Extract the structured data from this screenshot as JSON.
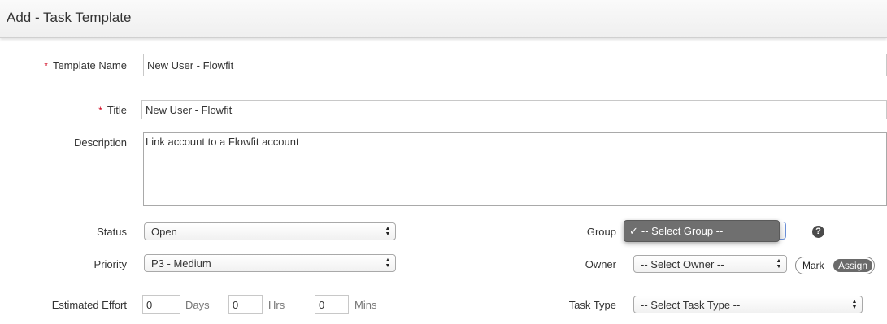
{
  "header": {
    "title": "Add - Task Template"
  },
  "form": {
    "template_name": {
      "label": "Template Name",
      "required_mark": "*",
      "value": "New User - Flowfit"
    },
    "title": {
      "label": "Title",
      "required_mark": "*",
      "value": "New User - Flowfit"
    },
    "description": {
      "label": "Description",
      "value": "Link account to a Flowfit account"
    },
    "status": {
      "label": "Status",
      "value": "Open"
    },
    "priority": {
      "label": "Priority",
      "value": "P3 - Medium"
    },
    "estimated_effort": {
      "label": "Estimated Effort",
      "days": {
        "value": "0",
        "unit": "Days"
      },
      "hrs": {
        "value": "0",
        "unit": "Hrs"
      },
      "mins": {
        "value": "0",
        "unit": "Mins"
      }
    },
    "group": {
      "label": "Group",
      "dropdown_selected": "-- Select Group --",
      "check": "✓"
    },
    "help_icon": {
      "symbol": "?"
    },
    "owner": {
      "label": "Owner",
      "value": "-- Select Owner --"
    },
    "owner_toggle": {
      "mark_label": "Mark",
      "assign_label": "Assign"
    },
    "task_type": {
      "label": "Task Type",
      "value": "-- Select Task Type --"
    }
  },
  "colors": {
    "required": "#d0021b",
    "dropdown_bg": "#6f6f6f",
    "toggle_active": "#6a6a6a"
  }
}
